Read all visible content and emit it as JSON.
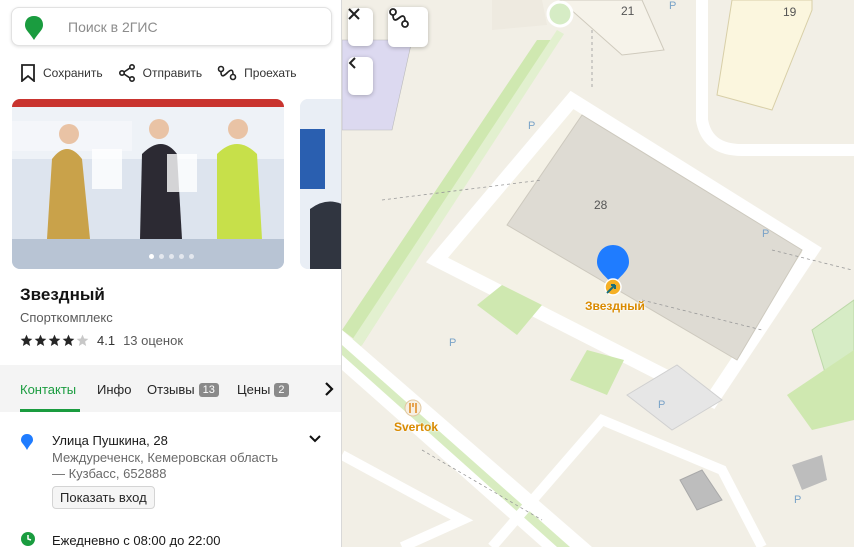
{
  "search": {
    "placeholder": "Поиск в 2ГИС"
  },
  "actions": [
    {
      "label": "Сохранить",
      "icon": "bookmark-icon"
    },
    {
      "label": "Отправить",
      "icon": "share-icon"
    },
    {
      "label": "Проехать",
      "icon": "route-icon"
    }
  ],
  "photos": {
    "count": 5,
    "active_index": 0
  },
  "place": {
    "name": "Звездный",
    "category": "Спорткомплекс",
    "rating": "4.1",
    "stars": 4,
    "reviews": "13 оценок"
  },
  "tabs": [
    {
      "label": "Контакты",
      "badge": ""
    },
    {
      "label": "Инфо",
      "badge": ""
    },
    {
      "label": "Отзывы",
      "badge": "13"
    },
    {
      "label": "Цены",
      "badge": "2"
    }
  ],
  "address": {
    "street": "Улица Пушкина, 28",
    "city": "Междуреченск, Кемеровская область",
    "region": "— Кузбасс, 652888",
    "entry_button": "Показать вход"
  },
  "hours": "Ежедневно с 08:00 до 22:00",
  "map": {
    "building_numbers": [
      "21",
      "19",
      "28"
    ],
    "marker_label": "Звездный",
    "poi_label": "Svertok",
    "parking_label": "P"
  },
  "colors": {
    "accent": "#1a9c3f",
    "marker": "#1f7cff",
    "poi": "#d98a00",
    "park": "#cfe8b0"
  }
}
